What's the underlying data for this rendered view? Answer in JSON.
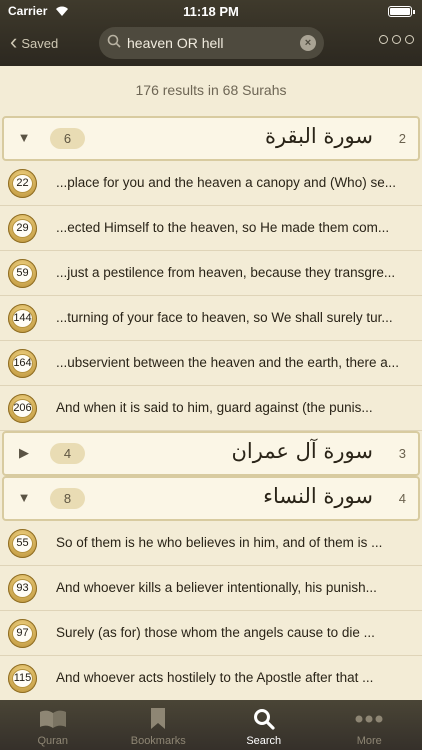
{
  "status_bar": {
    "carrier": "Carrier",
    "time": "11:18 PM"
  },
  "nav": {
    "back_label": "Saved",
    "search_value": "heaven OR hell",
    "more_icon": "more-icon"
  },
  "summary": "176 results in 68 Surahs",
  "surahs": [
    {
      "count": "6",
      "number": "2",
      "arabic": "سورة البقرة",
      "expanded": true,
      "verses": [
        {
          "num": "22",
          "text": "...place for you and the heaven a canopy and (Who) se..."
        },
        {
          "num": "29",
          "text": "...ected Himself to the heaven, so He made them com..."
        },
        {
          "num": "59",
          "text": "...just a pestilence from heaven, because they transgre..."
        },
        {
          "num": "144",
          "text": "...turning of your face to heaven, so We shall surely tur..."
        },
        {
          "num": "164",
          "text": "...ubservient between the heaven and the earth, there a..."
        },
        {
          "num": "206",
          "text": "And when it is said to him, guard against (the punis..."
        }
      ]
    },
    {
      "count": "4",
      "number": "3",
      "arabic": "سورة آل عمران",
      "expanded": false,
      "verses": []
    },
    {
      "count": "8",
      "number": "4",
      "arabic": "سورة النساء",
      "expanded": true,
      "verses": [
        {
          "num": "55",
          "text": "So of them is he who believes in him, and of them is ..."
        },
        {
          "num": "93",
          "text": "And whoever kills a believer intentionally, his punish..."
        },
        {
          "num": "97",
          "text": "Surely (as for) those whom the angels cause to die ..."
        },
        {
          "num": "115",
          "text": "And whoever acts hostilely to the Apostle after that ..."
        }
      ]
    }
  ],
  "tabs": [
    {
      "label": "Quran",
      "icon": "book-icon",
      "active": false
    },
    {
      "label": "Bookmarks",
      "icon": "bookmark-icon",
      "active": false
    },
    {
      "label": "Search",
      "icon": "search-icon",
      "active": true
    },
    {
      "label": "More",
      "icon": "more-dots-icon",
      "active": false
    }
  ]
}
